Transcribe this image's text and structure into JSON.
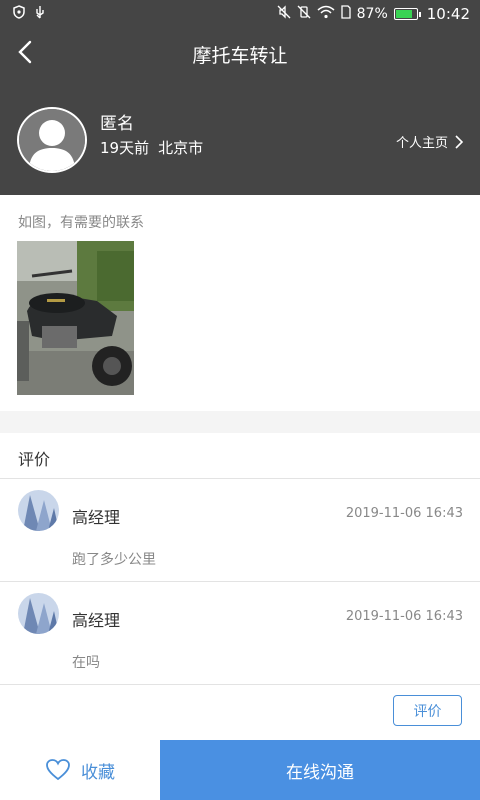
{
  "status_bar": {
    "left_icons": [
      "shield-icon",
      "usb-icon"
    ],
    "battery_percent_text": "87%",
    "battery_level": 0.87,
    "time": "10:42",
    "icons": [
      "mute-icon",
      "vibrate-off-icon",
      "wifi-icon",
      "sim-icon",
      "battery-icon"
    ]
  },
  "header": {
    "title": "摩托车转让",
    "back_icon": "chevron-left-icon"
  },
  "profile": {
    "name": "匿名",
    "time_ago": "19天前",
    "location": "北京市",
    "home_link": "个人主页",
    "avatar_icon": "user-avatar-icon"
  },
  "post": {
    "text": "如图，有需要的联系",
    "image_icon": "motorcycle-photo"
  },
  "comments": {
    "header": "评价",
    "items": [
      {
        "name": "高经理",
        "time": "2019-11-06 16:43",
        "text": "跑了多少公里"
      },
      {
        "name": "高经理",
        "time": "2019-11-06 16:43",
        "text": "在吗"
      }
    ],
    "review_button": "评价"
  },
  "bottom": {
    "favorite_label": "收藏",
    "chat_label": "在线沟通"
  },
  "colors": {
    "header_bg": "#454545",
    "accent": "#4a90e2",
    "battery": "#39d353"
  }
}
